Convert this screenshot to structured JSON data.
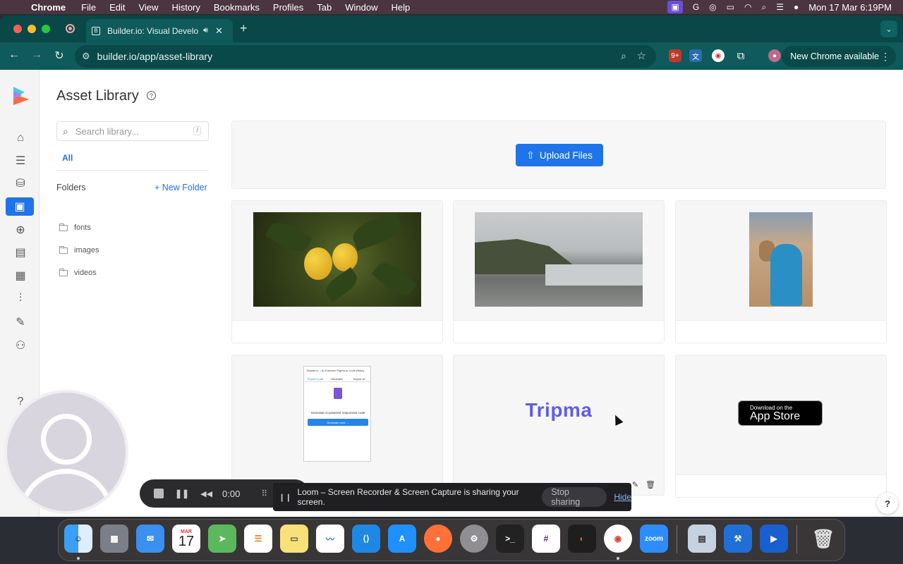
{
  "menubar": {
    "app": "Chrome",
    "menus": [
      "File",
      "Edit",
      "View",
      "History",
      "Bookmarks",
      "Profiles",
      "Tab",
      "Window",
      "Help"
    ],
    "clock": "Mon 17 Mar  6:19PM"
  },
  "browser": {
    "tab_title": "Builder.io: Visual Development",
    "url": "builder.io/app/asset-library",
    "new_chrome_label": "New Chrome available",
    "extension_badge": "9+"
  },
  "page": {
    "title": "Asset Library",
    "search_placeholder": "Search library...",
    "search_shortcut": "/",
    "filter_tab": "All",
    "folders_label": "Folders",
    "new_folder_label": "+ New Folder",
    "folders": [
      "fonts",
      "images",
      "videos"
    ],
    "upload_label": "Upload Files",
    "help_fab": "?"
  },
  "assets": {
    "shot": {
      "header": "Builder.io – AI-Powered Figma to Code (Beta)",
      "tabs": [
        "Export Code",
        "Generate",
        "Import UI"
      ],
      "caption": "Generate AI-powered responsive code",
      "button": "Generate code →"
    },
    "tripma_text": "Tripma",
    "appstore_line1": "Download on the",
    "appstore_line2": "App Store"
  },
  "loom": {
    "timer": "0:00",
    "share_message": "Loom – Screen Recorder & Screen Capture is sharing your screen.",
    "stop_sharing": "Stop sharing",
    "hide": "Hide"
  },
  "dock": {
    "calendar_month": "MAR",
    "calendar_day": "17",
    "zoom_label": "zoom"
  },
  "colors": {
    "accent": "#1e74e8",
    "browser_frame": "#0f5a5a",
    "tripma": "#605dec"
  }
}
